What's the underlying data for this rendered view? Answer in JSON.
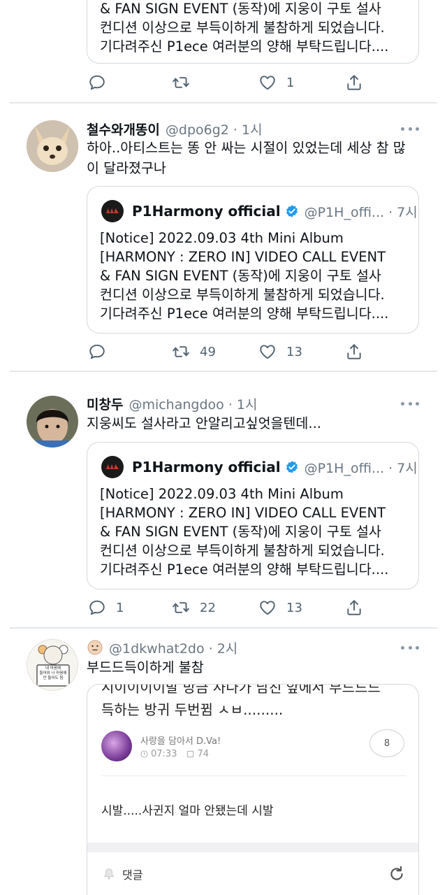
{
  "top_tweet": {
    "quote_lines": [
      "& FAN SIGN EVENT (동작)에 지웅이 구토 설사",
      "컨디션 이상으로 부득이하게 불참하게 되었습니다.",
      "기다려주신 P1ece 여러분의 양해 부탁드립니다...."
    ],
    "like_count": "1"
  },
  "tweets": [
    {
      "display_name": "철수와개똥이",
      "handle_time": "@dpo6g2 · 1시",
      "text_lines": [
        "하아..아티스트는 똥 안 싸는 시절이 있었는데 세상 참 많",
        "이 달라졌구나"
      ],
      "quote": {
        "name": "P1Harmony official",
        "meta": "@P1H_offi... · 7시",
        "lines": [
          "[Notice] 2022.09.03 4th Mini Album",
          "[HARMONY : ZERO IN] VIDEO CALL EVENT",
          "& FAN SIGN EVENT (동작)에 지웅이 구토 설사",
          "컨디션 이상으로 부득이하게 불참하게 되었습니다.",
          "기다려주신 P1ece 여러분의 양해 부탁드립니다...."
        ]
      },
      "reply_count": "",
      "retweet_count": "49",
      "like_count": "13"
    },
    {
      "display_name": "미창두",
      "handle_time": "@michangdoo · 1시",
      "text_lines": [
        "지웅씨도 설사라고 안알리고싶엇을텐데..."
      ],
      "quote": {
        "name": "P1Harmony official",
        "meta": "@P1H_offi... · 7시",
        "lines": [
          "[Notice] 2022.09.03 4th Mini Album",
          "[HARMONY : ZERO IN] VIDEO CALL EVENT",
          "& FAN SIGN EVENT (동작)에 지웅이 구토 설사",
          "컨디션 이상으로 부득이하게 불참하게 되었습니다.",
          "기다려주신 P1ece 여러분의 양해 부탁드립니다...."
        ]
      },
      "reply_count": "1",
      "retweet_count": "22",
      "like_count": "13"
    },
    {
      "display_name": "",
      "handle_time": "@1dkwhat2do · 2시",
      "text_lines": [
        "부드드득이하게 불참"
      ],
      "avatar_sign_lines": [
        "내 마음에",
        "들어와 나 마음에",
        "안 들어도 됨"
      ],
      "embedded": {
        "title_lines": [
          "시이이이이발 방금 사나가 남친 앞에서 부드드드",
          "득하는 방귀 두번뀜 ㅅㅂ........."
        ],
        "author": "사랑을 담아서 D.Va!",
        "time": "07:33",
        "views": "74",
        "comment_badge": "8",
        "body": "시발.....사귄지 얼마 안됐는데 시발",
        "comment_label": "댓글"
      }
    }
  ],
  "colors": {
    "text": "#0f1419",
    "secondary": "#536471",
    "divider": "#e3e7ea",
    "verified": "#1d9bf0"
  }
}
